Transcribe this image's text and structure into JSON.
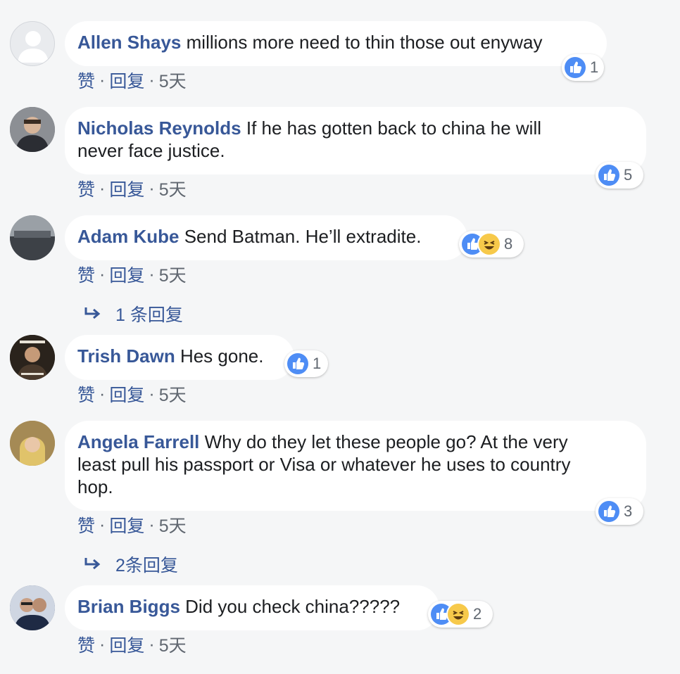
{
  "colors": {
    "background": "#f5f6f7",
    "author": "#385898",
    "like": "#4e8df5",
    "haha": "#f7c94a",
    "meta": "#606770"
  },
  "actions": {
    "like_label": "赞",
    "reply_label": "回复",
    "separator": "·"
  },
  "comments": [
    {
      "author": "Allen Shays",
      "text_lines": [
        "millions more need to thin those out enyway"
      ],
      "reaction_count": "1",
      "reactions": [
        "like"
      ],
      "timestamp": "5天"
    },
    {
      "author": "Nicholas Reynolds",
      "text_lines": [
        "If he has gotten back to china he will",
        "never face justice."
      ],
      "reaction_count": "5",
      "reactions": [
        "like"
      ],
      "timestamp": "5天"
    },
    {
      "author": "Adam Kube",
      "text_lines": [
        "Send Batman. He’ll extradite."
      ],
      "reaction_count": "8",
      "reactions": [
        "like",
        "haha"
      ],
      "timestamp": "5天",
      "replies_label": "1 条回复"
    },
    {
      "author": "Trish Dawn",
      "text_lines": [
        "Hes gone."
      ],
      "reaction_count": "1",
      "reactions": [
        "like"
      ],
      "timestamp": "5天"
    },
    {
      "author": "Angela Farrell",
      "text_lines": [
        "Why do they let these people go? At the very",
        "least pull his passport or Visa or whatever he uses to country",
        "hop."
      ],
      "reaction_count": "3",
      "reactions": [
        "like"
      ],
      "timestamp": "5天",
      "replies_label": "2条回复"
    },
    {
      "author": "Brian Biggs",
      "text_lines": [
        "Did you check china?????"
      ],
      "reaction_count": "2",
      "reactions": [
        "like",
        "haha"
      ],
      "timestamp": "5天"
    }
  ]
}
